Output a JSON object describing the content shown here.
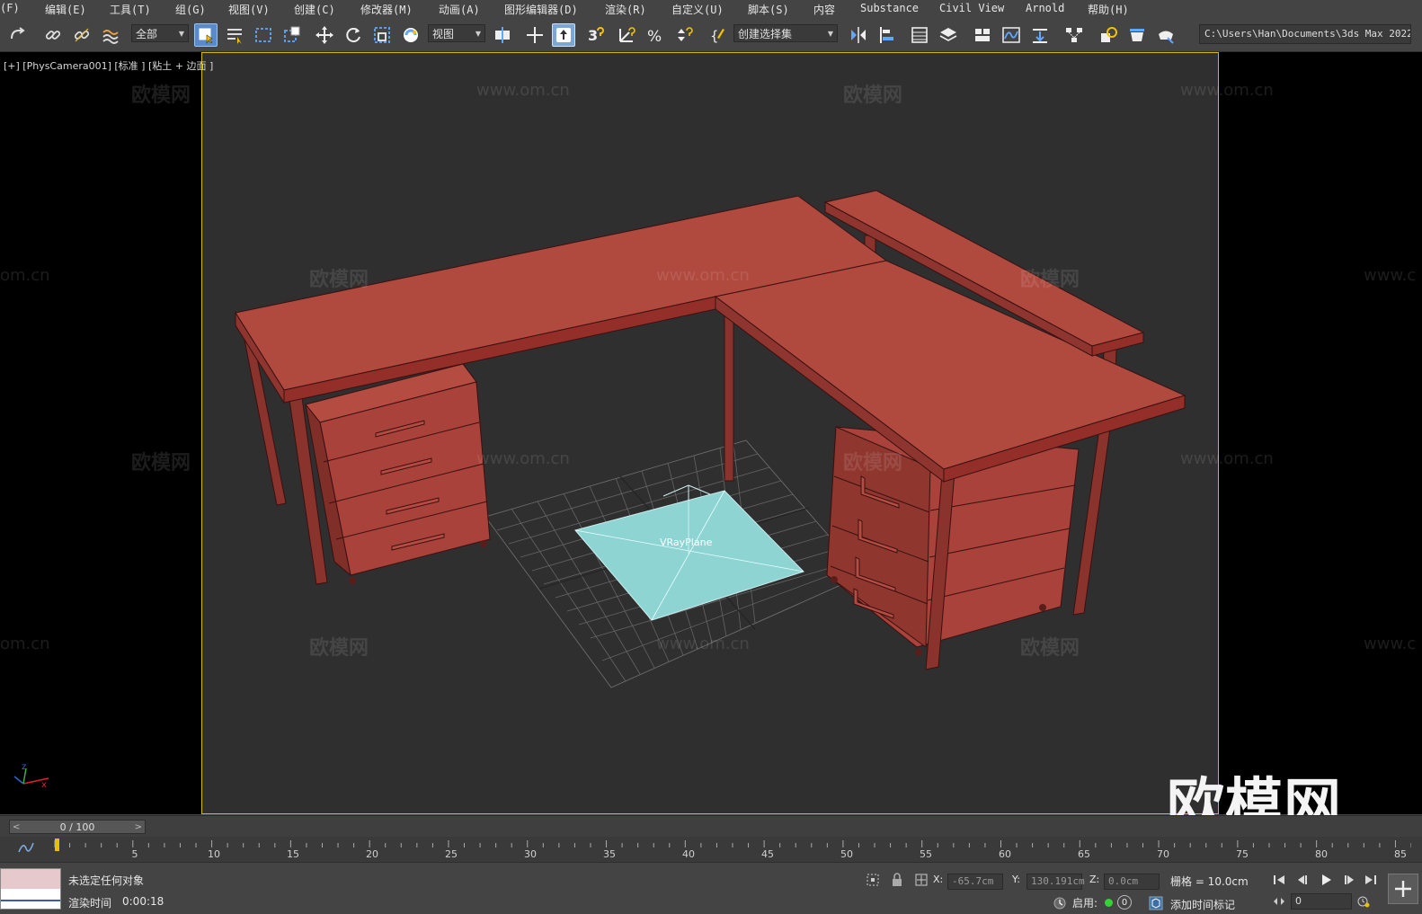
{
  "menu": {
    "items": [
      "(F)",
      "编辑(E)",
      "工具(T)",
      "组(G)",
      "视图(V)",
      "创建(C)",
      "修改器(M)",
      "动画(A)",
      "图形编辑器(D)",
      "渲染(R)",
      "自定义(U)",
      "脚本(S)",
      "内容",
      "Substance",
      "Civil View",
      "Arnold",
      "帮助(H)"
    ]
  },
  "toolbar": {
    "selection_filter": "全部",
    "ref_coord": "视图",
    "named_selection": "创建选择集",
    "snap_num": "3",
    "project_path": "C:\\Users\\Han\\Documents\\3ds Max 2022"
  },
  "viewport": {
    "label": "[+] [PhysCamera001] [标准 ] [粘土 + 边面 ]",
    "object_label": "VRayPlane",
    "watermark_cn": "欧模网",
    "watermark_url": "www.om.cn",
    "watermark_url_partial": "om.cn",
    "watermark_url_partial_right": "www.c",
    "big_watermark": "欧模网",
    "axis_x": "x",
    "axis_z": "z"
  },
  "timeline": {
    "frame_display": "0 / 100",
    "ticks": [
      "5",
      "10",
      "15",
      "20",
      "25",
      "30",
      "35",
      "40",
      "45",
      "50",
      "55",
      "60",
      "65",
      "70",
      "75",
      "80",
      "85"
    ]
  },
  "status": {
    "selection": "未选定任何对象",
    "render_time_label": "渲染时间",
    "render_time_value": "0:00:18",
    "x_label": "X:",
    "x_value": "-65.7cm",
    "y_label": "Y:",
    "y_value": "130.191cm",
    "z_label": "Z:",
    "z_value": "0.0cm",
    "grid_label": "栅格 = 10.0cm",
    "enable_label": "启用:",
    "enable_count": "0",
    "add_time_tag": "添加时间标记",
    "frame_field": "0"
  },
  "colors": {
    "desk": "#a9443a",
    "plane": "#8ed4d3",
    "viewport_border": "#d8b800",
    "viewport_bg": "#2f2f2f"
  }
}
